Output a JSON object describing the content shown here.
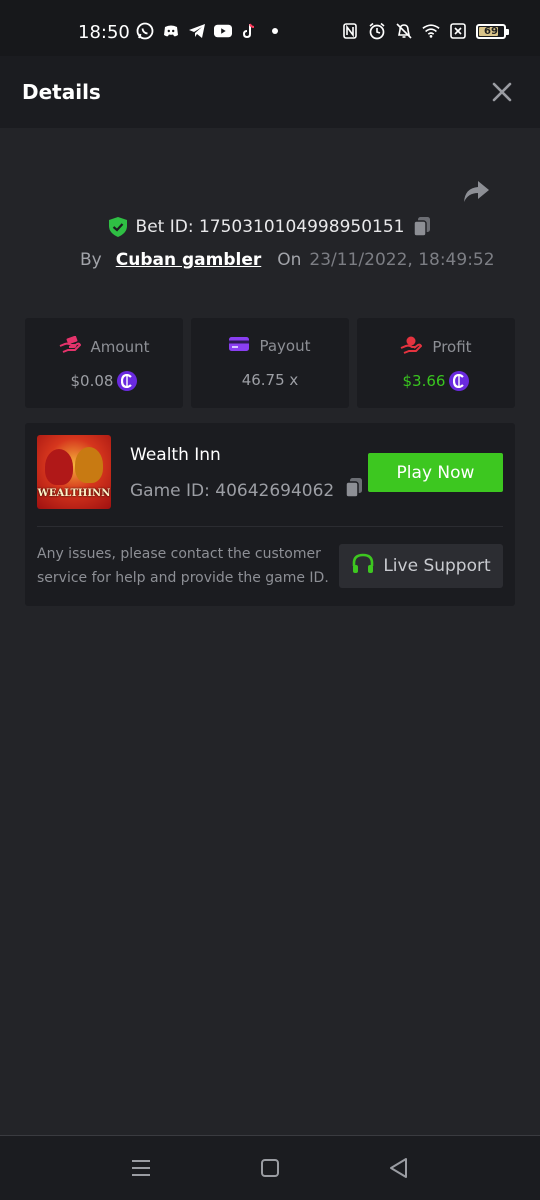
{
  "status_bar": {
    "time": "18:50",
    "battery": "69",
    "left_icons": [
      "whatsapp-icon",
      "discord-icon",
      "telegram-icon",
      "youtube-icon",
      "tiktok-icon",
      "dot-icon"
    ],
    "right_icons": [
      "nfc-icon",
      "alarm-icon",
      "bell-off-icon",
      "wifi-icon",
      "sim-off-icon",
      "battery-icon"
    ]
  },
  "header": {
    "title": "Details"
  },
  "bet": {
    "id_text": "Bet ID: 1750310104998950151",
    "by_label": "By",
    "user": "Cuban gambler",
    "on_label": "On",
    "date": "23/11/2022, 18:49:52"
  },
  "stats": {
    "amount": {
      "label": "Amount",
      "value": "$0.08",
      "icon": "money-hand-icon",
      "color": "#e5336b"
    },
    "payout": {
      "label": "Payout",
      "value": "46.75 x",
      "icon": "card-icon",
      "color": "#8a3ff2"
    },
    "profit": {
      "label": "Profit",
      "value": "$3.66",
      "icon": "profit-hand-icon",
      "color": "#e5333f"
    }
  },
  "game": {
    "name": "Wealth Inn",
    "id_text": "Game ID: 40642694062",
    "thumb_text": "WEALTHINN",
    "play_label": "Play Now",
    "issue_text": "Any issues, please contact the customer service for help and provide the game ID.",
    "support_label": "Live Support"
  },
  "colors": {
    "background": "#232428",
    "panel": "#1b1c20",
    "accent_green": "#3dc720",
    "coin_purple": "#6a2adf"
  }
}
